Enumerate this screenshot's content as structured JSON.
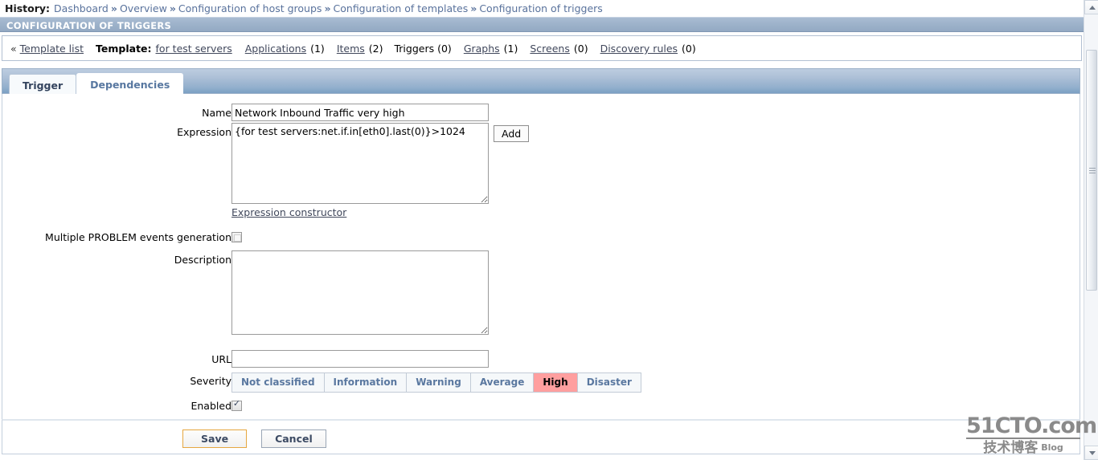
{
  "history": {
    "label": "History:",
    "separator": "»",
    "items": [
      "Dashboard",
      "Overview",
      "Configuration of host groups",
      "Configuration of templates",
      "Configuration of triggers"
    ]
  },
  "page_title": "CONFIGURATION OF TRIGGERS",
  "nav": {
    "chevron": "«",
    "template_list": "Template list",
    "template_label": "Template:",
    "template_name": "for test servers",
    "links": [
      {
        "label": "Applications",
        "count": "(1)",
        "is_link": true
      },
      {
        "label": "Items",
        "count": "(2)",
        "is_link": true
      },
      {
        "label": "Triggers",
        "count": "(0)",
        "is_link": false
      },
      {
        "label": "Graphs",
        "count": "(1)",
        "is_link": true
      },
      {
        "label": "Screens",
        "count": "(0)",
        "is_link": true
      },
      {
        "label": "Discovery rules",
        "count": "(0)",
        "is_link": true
      }
    ]
  },
  "tabs": [
    {
      "label": "Trigger",
      "active": true
    },
    {
      "label": "Dependencies",
      "active": false
    }
  ],
  "form": {
    "name_label": "Name",
    "name_value": "Network Inbound Traffic very high",
    "name_placeholder": "",
    "expression_label": "Expression",
    "expression_value": "{for test servers:net.if.in[eth0].last(0)}>1024",
    "expression_placeholder": "",
    "add_button": "Add",
    "expression_constructor": "Expression constructor",
    "multiple_problem_label": "Multiple PROBLEM events generation",
    "multiple_problem_checked": false,
    "description_label": "Description",
    "description_value": "",
    "description_placeholder": "",
    "url_label": "URL",
    "url_value": "",
    "url_placeholder": "",
    "severity_label": "Severity",
    "severity_options": [
      "Not classified",
      "Information",
      "Warning",
      "Average",
      "High",
      "Disaster"
    ],
    "severity_selected": "High",
    "enabled_label": "Enabled",
    "enabled_checked": true
  },
  "footer": {
    "save_label": "Save",
    "cancel_label": "Cancel"
  },
  "watermark": {
    "top": "51CTO.com",
    "bottom": "技术博客",
    "blog": "Blog"
  },
  "colors": {
    "title_bar": "#9db2ca",
    "severity_selected_bg": "#ff9f9f",
    "save_border": "#e6a740",
    "link": "#41485c"
  }
}
